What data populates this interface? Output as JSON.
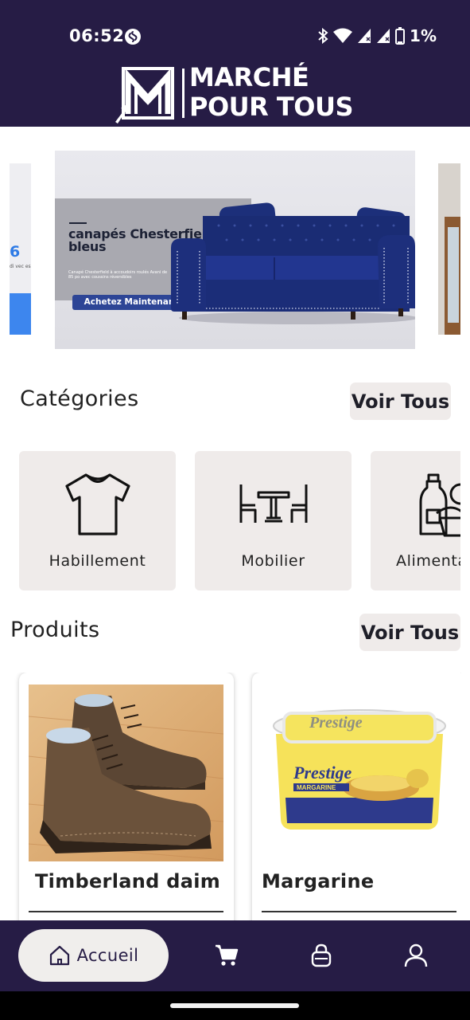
{
  "status_bar": {
    "time": "06:52",
    "battery": "1%",
    "icons": [
      "shazam-icon",
      "bluetooth-icon",
      "wifi-icon",
      "signal-icon",
      "signal-icon",
      "battery-icon"
    ]
  },
  "header": {
    "logo_line1": "MARCHÉ",
    "logo_line2": "POUR TOUS",
    "bg_color": "#261c45"
  },
  "banner": {
    "title": "canapés Chesterfield bleus",
    "subtitle": "Canapé Chesterfield à accoudoirs roulés Avani de 85 po avec coussins réversibles",
    "cta": "Achetez Maintenant",
    "peek_left_number": "6",
    "peek_left_text": "di vec es"
  },
  "categories": {
    "title": "Catégories",
    "see_all": "Voir Tous",
    "items": [
      {
        "label": "Habillement",
        "icon": "tshirt-icon"
      },
      {
        "label": "Mobilier",
        "icon": "table-chairs-icon"
      },
      {
        "label": "Alimentation",
        "icon": "groceries-icon"
      }
    ]
  },
  "products": {
    "title": "Produits",
    "see_all": "Voir Tous",
    "items": [
      {
        "name": "Timberland daim",
        "image": "boots-image"
      },
      {
        "name": "Margarine",
        "image": "margarine-tub-image",
        "brand_text": "Prestige",
        "sub_text": "MARGARINE"
      }
    ]
  },
  "bottom_nav": {
    "home_label": "Accueil",
    "items": [
      "home-icon",
      "cart-icon",
      "bag-icon",
      "user-icon"
    ]
  }
}
